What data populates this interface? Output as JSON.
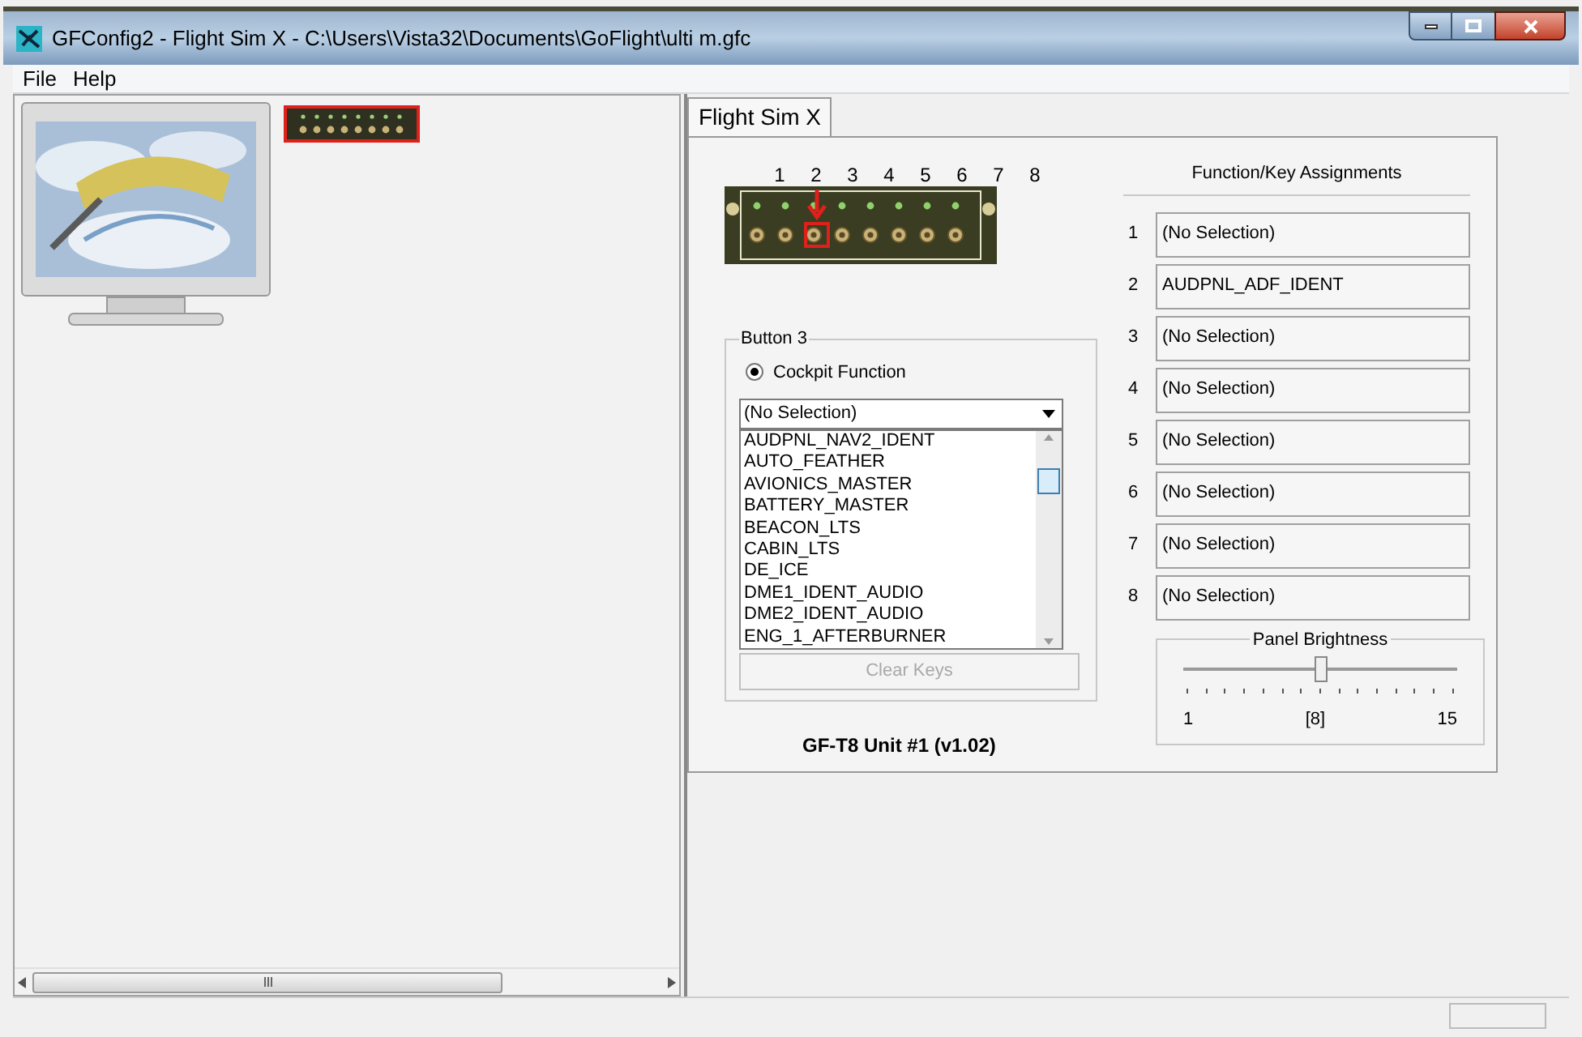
{
  "window": {
    "title": "GFConfig2 - Flight Sim X - C:\\Users\\Vista32\\Documents\\GoFlight\\ulti m.gfc"
  },
  "menu": [
    "File",
    "Help"
  ],
  "device_thumbnail": {
    "selected": true
  },
  "tabs": [
    {
      "label": "Flight Sim X",
      "selected": true
    }
  ],
  "button_numbers": [
    "1",
    "2",
    "3",
    "4",
    "5",
    "6",
    "7",
    "8"
  ],
  "button_group": {
    "title": "Button 3",
    "radio": {
      "label": "Cockpit Function",
      "selected": true
    },
    "dropdown": {
      "value": "(No Selection)"
    },
    "list": [
      "AUDPNL_NAV2_IDENT",
      "AUTO_FEATHER",
      "AVIONICS_MASTER",
      "BATTERY_MASTER",
      "BEACON_LTS",
      "CABIN_LTS",
      "DE_ICE",
      "DME1_IDENT_AUDIO",
      "DME2_IDENT_AUDIO",
      "ENG_1_AFTERBURNER"
    ],
    "clear_button": {
      "label": "Clear Keys",
      "disabled": true
    }
  },
  "unit_label": "GF-T8 Unit #1 (v1.02)",
  "assignments": {
    "title": "Function/Key Assignments",
    "rows": [
      {
        "number": "1",
        "value": "(No Selection)"
      },
      {
        "number": "2",
        "value": "AUDPNL_ADF_IDENT"
      },
      {
        "number": "3",
        "value": "(No Selection)"
      },
      {
        "number": "4",
        "value": "(No Selection)"
      },
      {
        "number": "5",
        "value": "(No Selection)"
      },
      {
        "number": "6",
        "value": "(No Selection)"
      },
      {
        "number": "7",
        "value": "(No Selection)"
      },
      {
        "number": "8",
        "value": "(No Selection)"
      }
    ]
  },
  "brightness": {
    "title": "Panel Brightness",
    "level": 0.5,
    "min_label": "1",
    "value_label": "[8]",
    "max_label": "15"
  }
}
